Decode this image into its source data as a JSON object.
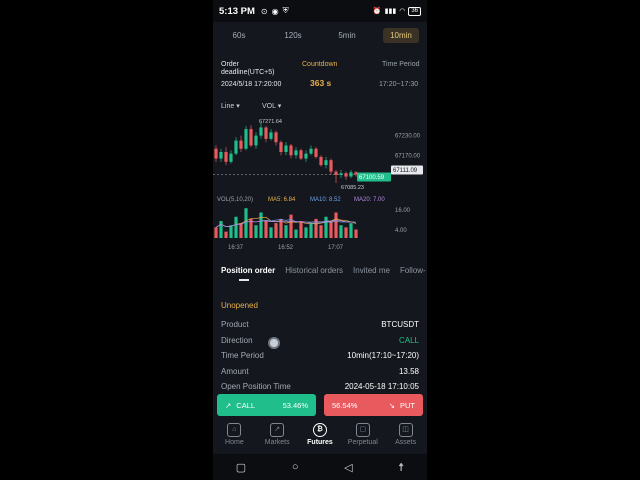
{
  "status_bar": {
    "time": "5:13 PM",
    "battery": "36"
  },
  "interval_tabs": [
    "60s",
    "120s",
    "5min",
    "10min"
  ],
  "order_info": {
    "deadline_label": "Order deadline(UTC+5)",
    "deadline_value": "2024/5/18 17:20:00",
    "countdown_label": "Countdown",
    "countdown_value": "363 s",
    "period_label": "Time Period",
    "period_value": "17:20~17:30"
  },
  "chart_controls": {
    "type_select": "Line",
    "indicator_select": "VOL"
  },
  "chart_data": {
    "type": "candlestick",
    "price_axis": [
      "67230.00",
      "67170.00",
      "67111.09"
    ],
    "high_label": "67271.64",
    "low_label": "67085.23",
    "current_price": "67100.59",
    "last_price": "67111.09",
    "x_ticks": [
      "16:37",
      "16:52",
      "17:07"
    ],
    "volume": {
      "header": "VOL(5,10,20)",
      "ma5": "MA5: 6.84",
      "ma10": "MA10: 8.52",
      "ma20": "MA20: 7.00",
      "axis": [
        "16.00",
        "4.00"
      ]
    },
    "candles": [
      {
        "o": 67190,
        "c": 67160,
        "h": 67200,
        "l": 67150
      },
      {
        "o": 67160,
        "c": 67180,
        "h": 67190,
        "l": 67150
      },
      {
        "o": 67180,
        "c": 67150,
        "h": 67195,
        "l": 67140
      },
      {
        "o": 67150,
        "c": 67175,
        "h": 67185,
        "l": 67145
      },
      {
        "o": 67175,
        "c": 67215,
        "h": 67225,
        "l": 67170
      },
      {
        "o": 67215,
        "c": 67190,
        "h": 67230,
        "l": 67180
      },
      {
        "o": 67190,
        "c": 67250,
        "h": 67260,
        "l": 67185
      },
      {
        "o": 67250,
        "c": 67200,
        "h": 67262,
        "l": 67195
      },
      {
        "o": 67200,
        "c": 67230,
        "h": 67240,
        "l": 67190
      },
      {
        "o": 67230,
        "c": 67255,
        "h": 67271.64,
        "l": 67220
      },
      {
        "o": 67255,
        "c": 67220,
        "h": 67260,
        "l": 67210
      },
      {
        "o": 67220,
        "c": 67240,
        "h": 67250,
        "l": 67215
      },
      {
        "o": 67240,
        "c": 67210,
        "h": 67245,
        "l": 67200
      },
      {
        "o": 67210,
        "c": 67180,
        "h": 67215,
        "l": 67170
      },
      {
        "o": 67180,
        "c": 67200,
        "h": 67210,
        "l": 67170
      },
      {
        "o": 67200,
        "c": 67170,
        "h": 67205,
        "l": 67160
      },
      {
        "o": 67170,
        "c": 67185,
        "h": 67195,
        "l": 67160
      },
      {
        "o": 67185,
        "c": 67160,
        "h": 67190,
        "l": 67155
      },
      {
        "o": 67160,
        "c": 67175,
        "h": 67185,
        "l": 67150
      },
      {
        "o": 67175,
        "c": 67190,
        "h": 67200,
        "l": 67170
      },
      {
        "o": 67190,
        "c": 67165,
        "h": 67195,
        "l": 67160
      },
      {
        "o": 67165,
        "c": 67140,
        "h": 67170,
        "l": 67135
      },
      {
        "o": 67140,
        "c": 67155,
        "h": 67165,
        "l": 67130
      },
      {
        "o": 67155,
        "c": 67120,
        "h": 67160,
        "l": 67110
      },
      {
        "o": 67120,
        "c": 67110,
        "h": 67125,
        "l": 67085.23
      },
      {
        "o": 67110,
        "c": 67115,
        "h": 67125,
        "l": 67100
      },
      {
        "o": 67115,
        "c": 67105,
        "h": 67120,
        "l": 67095
      },
      {
        "o": 67105,
        "c": 67118,
        "h": 67125,
        "l": 67100
      },
      {
        "o": 67118,
        "c": 67111.09,
        "h": 67122,
        "l": 67105
      }
    ],
    "volumes": [
      5,
      8,
      3,
      6,
      10,
      7,
      14,
      9,
      6,
      12,
      8,
      5,
      7,
      9,
      6,
      11,
      4,
      8,
      5,
      7,
      9,
      6,
      10,
      8,
      12,
      6,
      5,
      7,
      4
    ]
  },
  "order_tabs": [
    "Position order",
    "Historical orders",
    "Invited me",
    "Follow-"
  ],
  "position": {
    "status": "Unopened",
    "rows": [
      {
        "k": "Product",
        "v": "BTCUSDT"
      },
      {
        "k": "Direction",
        "v": "CALL"
      },
      {
        "k": "Time Period",
        "v": "10min(17:10~17:20)"
      },
      {
        "k": "Amount",
        "v": "13.58"
      },
      {
        "k": "Open Position Time",
        "v": "2024-05-18 17:10:05"
      }
    ]
  },
  "actions": {
    "call_label": "CALL",
    "call_pct": "53.46%",
    "put_pct": "56.54%",
    "put_label": "PUT"
  },
  "bottom_nav": [
    "Home",
    "Markets",
    "Futures",
    "Perpetual",
    "Assets"
  ],
  "colors": {
    "up": "#1fbe8a",
    "down": "#e95a5f",
    "accent": "#e7b04c"
  }
}
